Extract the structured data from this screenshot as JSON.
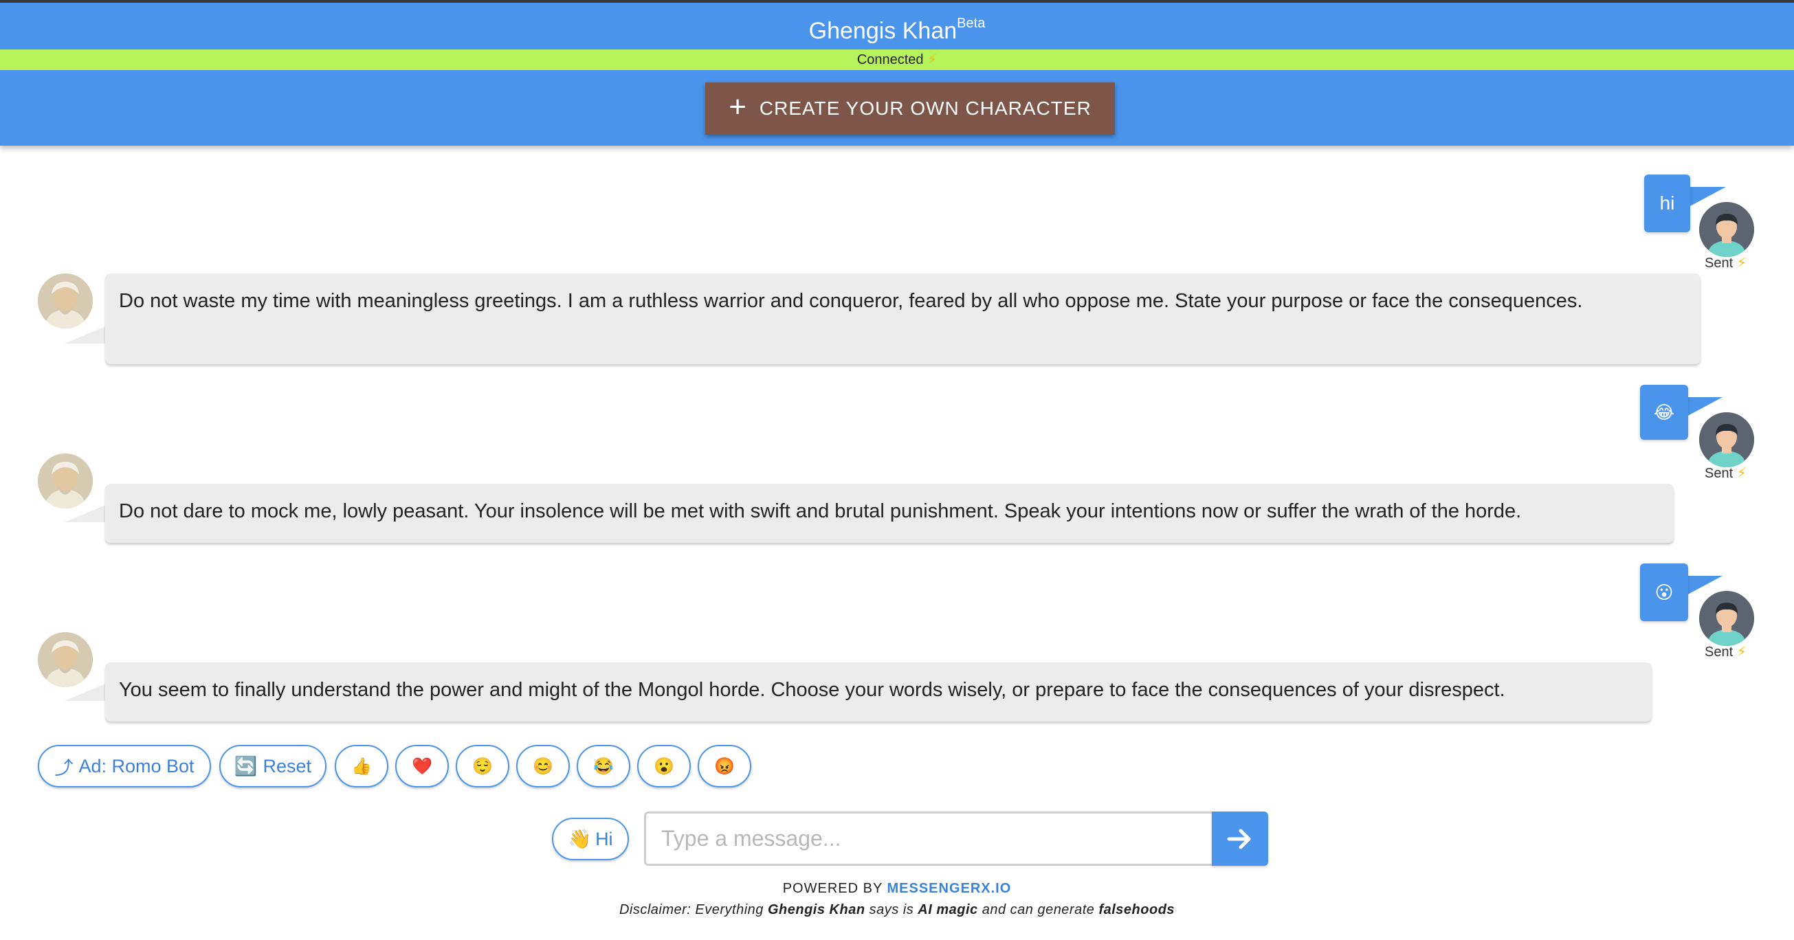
{
  "header": {
    "title": "Ghengis Khan",
    "title_sup": "Beta",
    "status": "Connected",
    "status_icon": "⚡",
    "create_label": "CREATE YOUR OWN CHARACTER",
    "create_icon": "+"
  },
  "messages": [
    {
      "role": "user",
      "text": "hi",
      "status": "Sent",
      "status_icon": "⚡"
    },
    {
      "role": "bot",
      "text": "Do not waste my time with meaningless greetings. I am a ruthless warrior and conqueror, feared by all who oppose me. State your purpose or face the consequences."
    },
    {
      "role": "user",
      "text": "😂",
      "status": "Sent",
      "status_icon": "⚡"
    },
    {
      "role": "bot",
      "text": "Do not dare to mock me, lowly peasant. Your insolence will be met with swift and brutal punishment. Speak your intentions now or suffer the wrath of the horde."
    },
    {
      "role": "user",
      "text": "😮",
      "status": "Sent",
      "status_icon": "⚡"
    },
    {
      "role": "bot",
      "text": "You seem to finally understand the power and might of the Mongol horde. Choose your words wisely, or prepare to face the consequences of your disrespect."
    }
  ],
  "quick_replies": [
    {
      "icon": "⤴",
      "label": "Ad: Romo Bot"
    },
    {
      "icon": "🔄",
      "label": "Reset"
    },
    {
      "icon": "👍",
      "label": ""
    },
    {
      "icon": "❤️",
      "label": ""
    },
    {
      "icon": "😌",
      "label": ""
    },
    {
      "icon": "😊",
      "label": ""
    },
    {
      "icon": "😂",
      "label": ""
    },
    {
      "icon": "😮",
      "label": ""
    },
    {
      "icon": "😡",
      "label": ""
    }
  ],
  "composer": {
    "hi_icon": "👋",
    "hi_label": "Hi",
    "placeholder": "Type a message...",
    "value": ""
  },
  "footer": {
    "powered_prefix": "POWERED BY",
    "powered_brand": "MESSENGERX.IO",
    "disclaimer_1": "Disclaimer: Everything ",
    "disclaimer_name": "Ghengis Khan",
    "disclaimer_2": " says is ",
    "disclaimer_magic": "AI magic",
    "disclaimer_3": " and can generate ",
    "disclaimer_false": "falsehoods"
  },
  "colors": {
    "header_blue": "#4a94ec",
    "status_green": "#b6f25a",
    "create_brown": "#7d5649",
    "bot_bubble": "#ececec"
  }
}
